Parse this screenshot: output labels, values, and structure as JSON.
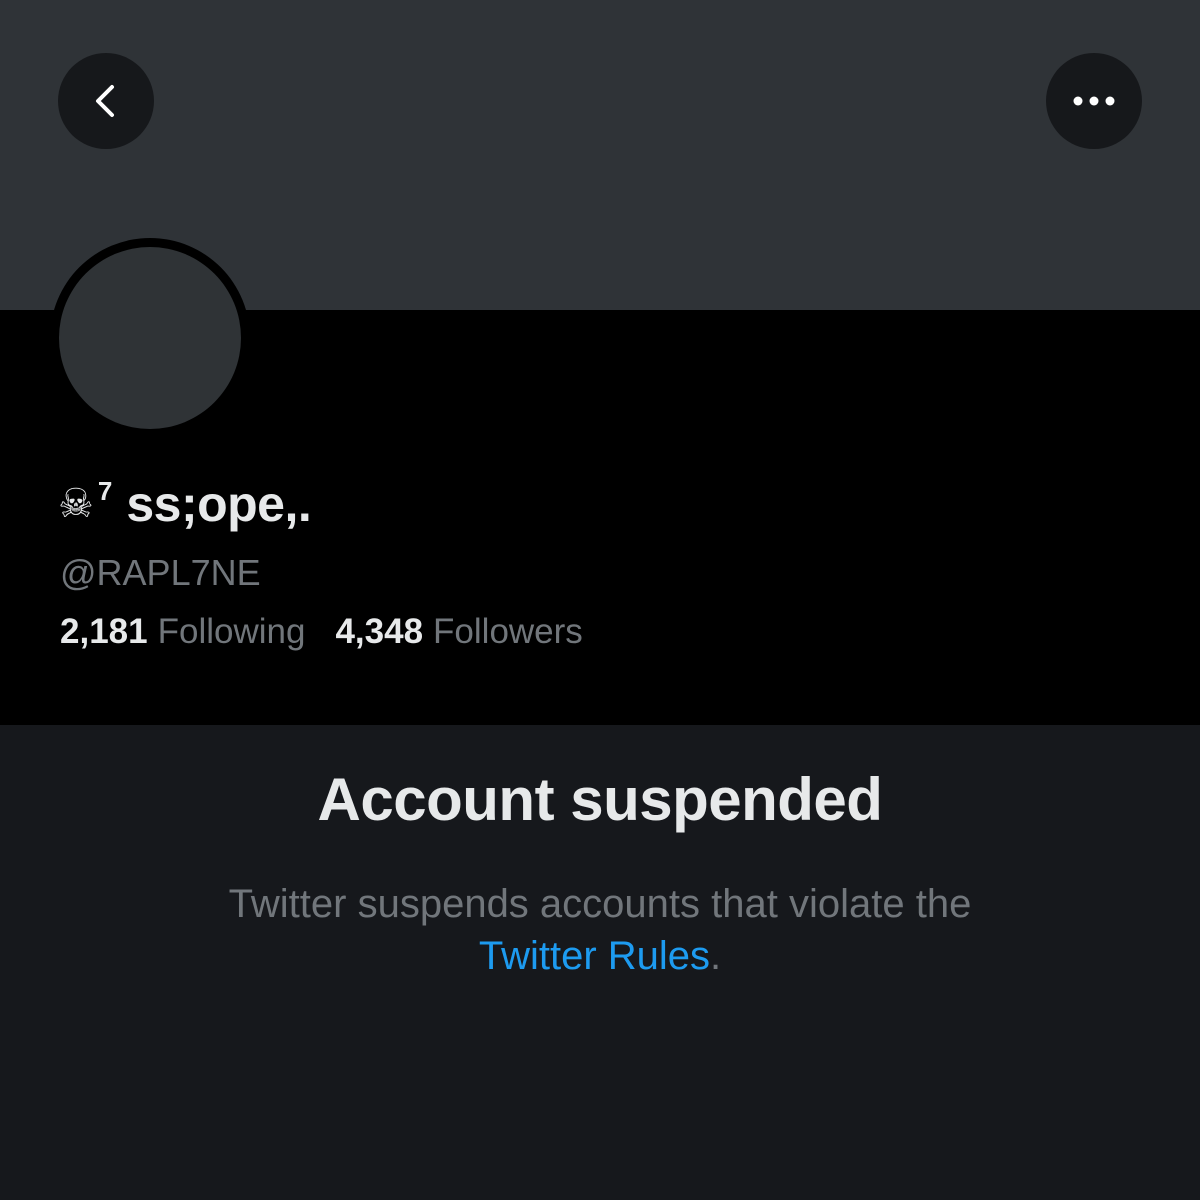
{
  "header": {
    "back_icon": "chevron-left-icon",
    "more_icon": "more-horizontal-icon"
  },
  "profile": {
    "name_emoji": "☠",
    "name_superscript": "7",
    "name": "ss;ope,.",
    "handle": "@RAPL7NE",
    "following_count": "2,181",
    "following_label": "Following",
    "followers_count": "4,348",
    "followers_label": "Followers"
  },
  "suspension": {
    "title": "Account suspended",
    "description": "Twitter suspends accounts that violate the",
    "link_text": "Twitter Rules",
    "suffix": "."
  },
  "colors": {
    "background": "#16181c",
    "banner": "#2f3337",
    "profile_bg": "#000000",
    "text_primary": "#e7e9ea",
    "text_secondary": "#71767b",
    "link": "#1d9bf0"
  }
}
